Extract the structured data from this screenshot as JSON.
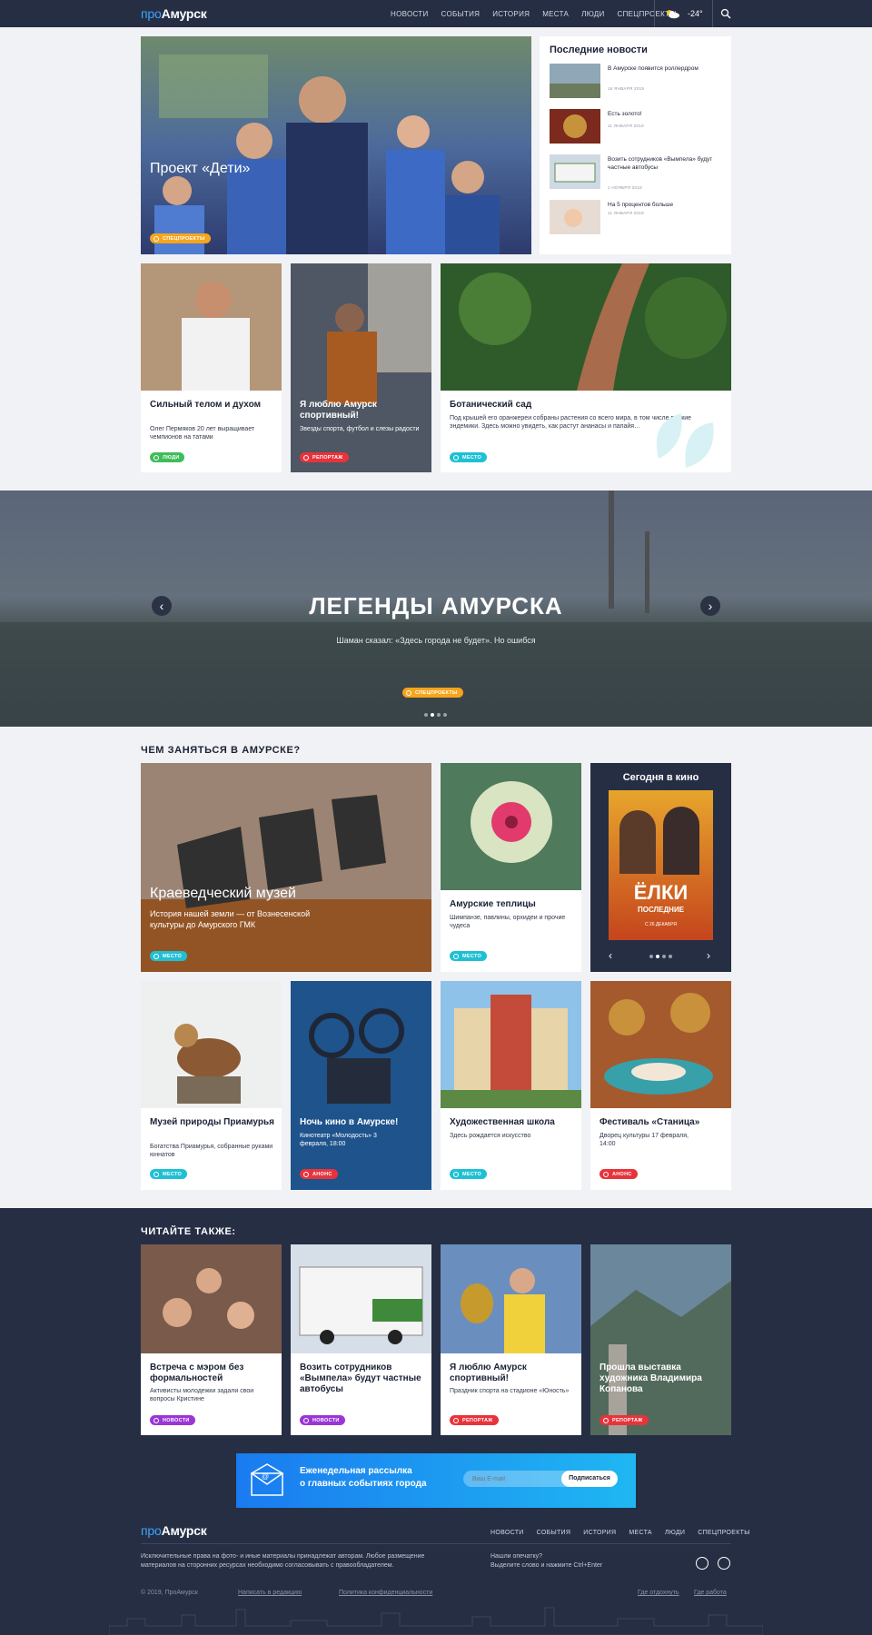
{
  "header": {
    "logo_pro": "про",
    "logo_name": "Амурск",
    "nav": [
      "НОВОСТИ",
      "СОБЫТИЯ",
      "ИСТОРИЯ",
      "МЕСТА",
      "ЛЮДИ",
      "СПЕЦПРОЕКТЫ"
    ],
    "temperature": "-24°"
  },
  "hero": {
    "title": "Проект «Дети»",
    "badge": "СПЕЦПРОЕКТЫ"
  },
  "latest": {
    "title": "Последние новости",
    "items": [
      {
        "text": "В Амурске появится роллердром",
        "date": "16 ЯНВАРЯ 2019"
      },
      {
        "text": "Есть золото!",
        "date": "11 ЯНВАРЯ 2019"
      },
      {
        "text": "Возить сотрудников «Вымпела» будут частные автобусы",
        "date": "1 НОЯБРЯ 2018"
      },
      {
        "text": "На 5 процентов больше",
        "date": "11 ЯНВАРЯ 2019"
      }
    ]
  },
  "cards_row1": [
    {
      "title": "Сильный телом и духом",
      "desc": "Олег Пермяков 20 лет выращивает чемпионов на татами",
      "badge": "ЛЮДИ"
    },
    {
      "title": "Я люблю Амурск спортивный!",
      "desc": "Звезды спорта, футбол и слезы радости",
      "badge": "РЕПОРТАЖ"
    },
    {
      "title": "Ботанический сад",
      "desc": "Под крышей его оранжереи собраны растения со всего мира, в том числе редкие эндемики. Здесь можно увидеть, как растут ананасы и папайя…",
      "badge": "МЕСТО"
    }
  ],
  "legends": {
    "title": "ЛЕГЕНДЫ АМУРСКА",
    "subtitle": "Шаман сказал: «Здесь города не будет». Но ошибся",
    "badge": "СПЕЦПРОЕКТЫ"
  },
  "what_to_do": {
    "title": "ЧЕМ ЗАНЯТЬСЯ В АМУРСКЕ?",
    "museum": {
      "title": "Краеведческий музей",
      "desc": "История нашей земли — от Вознесенской культуры до Амурского ГМК",
      "badge": "МЕСТО"
    },
    "greenhouse": {
      "title": "Амурские теплицы",
      "desc": "Шимпанзе, павлины, орхидеи и прочие чудеса",
      "badge": "МЕСТО"
    },
    "cinema": {
      "title": "Сегодня в кино",
      "poster_title": "ЁЛКИ",
      "poster_sub": "ПОСЛЕДНИЕ",
      "poster_date": "С 26 ДЕКАБРЯ"
    },
    "row2": [
      {
        "title": "Музей природы Приамурья",
        "desc": "Богатства Приамурья, собранные руками юннатов",
        "badge": "МЕСТО"
      },
      {
        "title": "Ночь кино в Амурске!",
        "desc": "Кинотеатр «Молодость» 3 февраля, 18:00",
        "badge": "АНОНС"
      },
      {
        "title": "Художественная школа",
        "desc": "Здесь рождается искусство",
        "badge": "МЕСТО"
      },
      {
        "title": "Фестиваль «Станица»",
        "desc": "Дворец культуры 17 февраля, 14:00",
        "badge": "АНОНС"
      }
    ]
  },
  "read_also": {
    "title": "ЧИТАЙТЕ ТАКЖЕ:",
    "items": [
      {
        "title": "Встреча с мэром без формальностей",
        "desc": "Активисты молодежки задали свои вопросы Кристине",
        "badge": "НОВОСТИ"
      },
      {
        "title": "Возить сотрудников «Вымпела» будут частные автобусы",
        "desc": "",
        "badge": "НОВОСТИ"
      },
      {
        "title": "Я люблю Амурск спортивный!",
        "desc": "Праздник спорта на стадионе «Юность»",
        "badge": "РЕПОРТАЖ"
      },
      {
        "title": "Прошла выставка художника Владимира Копанова",
        "desc": "",
        "badge": "РЕПОРТАЖ"
      }
    ]
  },
  "newsletter": {
    "text1": "Еженедельная рассылка",
    "text2": "о главных событиях города",
    "placeholder": "Ваш E-mail",
    "button": "Подписаться"
  },
  "footer": {
    "nav": [
      "НОВОСТИ",
      "СОБЫТИЯ",
      "ИСТОРИЯ",
      "МЕСТА",
      "ЛЮДИ",
      "СПЕЦПРОЕКТЫ"
    ],
    "rights": "Исключительные права на фото- и иные материалы принадлежат авторам. Любое размещение материалов на сторонних ресурсах необходимо согласовывать с правообладателем.",
    "typo1": "Нашли опечатку?",
    "typo2": "Выделите слово и нажмите Ctrl+Enter",
    "copyright": "© 2019, ПроАмурск",
    "write": "Написать в редакцию",
    "privacy": "Политика конфиденциальности",
    "where_rest": "Где отдохнуть",
    "where_work": "Где работа"
  }
}
